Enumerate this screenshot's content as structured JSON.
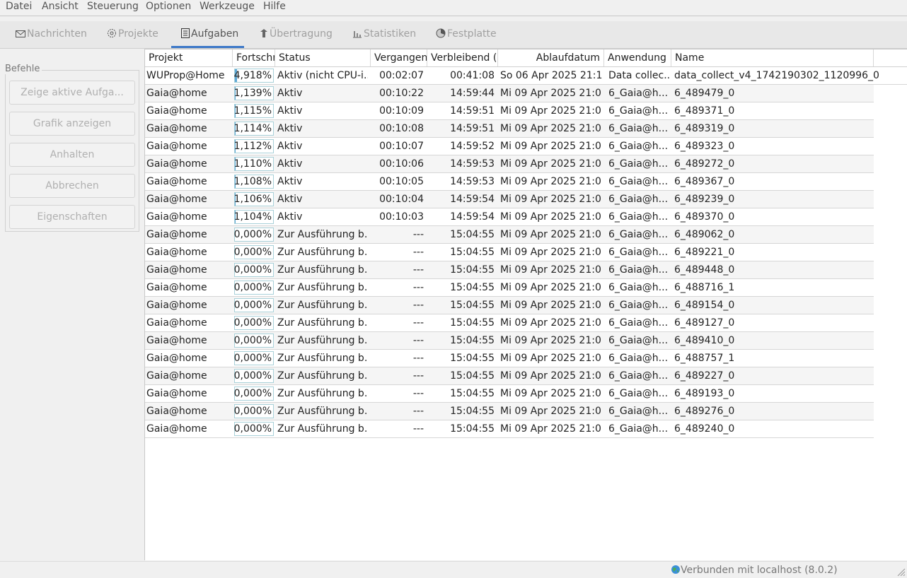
{
  "menu": [
    "Datei",
    "Ansicht",
    "Steuerung",
    "Optionen",
    "Werkzeuge",
    "Hilfe"
  ],
  "tabs": [
    {
      "label": "Nachrichten",
      "icon": "envelope-icon"
    },
    {
      "label": "Projekte",
      "icon": "projects-icon"
    },
    {
      "label": "Aufgaben",
      "icon": "tasks-icon",
      "active": true
    },
    {
      "label": "Übertragung",
      "icon": "transfer-icon"
    },
    {
      "label": "Statistiken",
      "icon": "statistics-icon"
    },
    {
      "label": "Festplatte",
      "icon": "disk-icon"
    }
  ],
  "commands": {
    "title": "Befehle",
    "buttons": [
      "Zeige aktive Aufga...",
      "Grafik anzeigen",
      "Anhalten",
      "Abbrechen",
      "Eigenschaften"
    ]
  },
  "columns": [
    "Projekt",
    "Fortschr",
    "Status",
    "Vergangen",
    "Verbleibend (g",
    "Ablaufdatum",
    "Anwendung",
    "Name"
  ],
  "rows": [
    {
      "project": "WUProp@Home",
      "progress": "4,918%",
      "progress_value": 4.918,
      "status": "Aktiv (nicht CPU-i...",
      "elapsed": "00:02:07",
      "remaining": "00:41:08",
      "deadline": "So 06 Apr 2025 21:1...",
      "app": "Data collec...",
      "name": "data_collect_v4_1742190302_1120996_0"
    },
    {
      "project": "Gaia@home",
      "progress": "1,139%",
      "progress_value": 1.139,
      "status": "Aktiv",
      "elapsed": "00:10:22",
      "remaining": "14:59:44",
      "deadline": "Mi 09 Apr 2025 21:0...",
      "app": "6_Gaia@h...",
      "name": "6_489479_0"
    },
    {
      "project": "Gaia@home",
      "progress": "1,115%",
      "progress_value": 1.115,
      "status": "Aktiv",
      "elapsed": "00:10:09",
      "remaining": "14:59:51",
      "deadline": "Mi 09 Apr 2025 21:0...",
      "app": "6_Gaia@h...",
      "name": "6_489371_0"
    },
    {
      "project": "Gaia@home",
      "progress": "1,114%",
      "progress_value": 1.114,
      "status": "Aktiv",
      "elapsed": "00:10:08",
      "remaining": "14:59:51",
      "deadline": "Mi 09 Apr 2025 21:0...",
      "app": "6_Gaia@h...",
      "name": "6_489319_0"
    },
    {
      "project": "Gaia@home",
      "progress": "1,112%",
      "progress_value": 1.112,
      "status": "Aktiv",
      "elapsed": "00:10:07",
      "remaining": "14:59:52",
      "deadline": "Mi 09 Apr 2025 21:0...",
      "app": "6_Gaia@h...",
      "name": "6_489323_0"
    },
    {
      "project": "Gaia@home",
      "progress": "1,110%",
      "progress_value": 1.11,
      "status": "Aktiv",
      "elapsed": "00:10:06",
      "remaining": "14:59:53",
      "deadline": "Mi 09 Apr 2025 21:0...",
      "app": "6_Gaia@h...",
      "name": "6_489272_0"
    },
    {
      "project": "Gaia@home",
      "progress": "1,108%",
      "progress_value": 1.108,
      "status": "Aktiv",
      "elapsed": "00:10:05",
      "remaining": "14:59:53",
      "deadline": "Mi 09 Apr 2025 21:0...",
      "app": "6_Gaia@h...",
      "name": "6_489367_0"
    },
    {
      "project": "Gaia@home",
      "progress": "1,106%",
      "progress_value": 1.106,
      "status": "Aktiv",
      "elapsed": "00:10:04",
      "remaining": "14:59:54",
      "deadline": "Mi 09 Apr 2025 21:0...",
      "app": "6_Gaia@h...",
      "name": "6_489239_0"
    },
    {
      "project": "Gaia@home",
      "progress": "1,104%",
      "progress_value": 1.104,
      "status": "Aktiv",
      "elapsed": "00:10:03",
      "remaining": "14:59:54",
      "deadline": "Mi 09 Apr 2025 21:0...",
      "app": "6_Gaia@h...",
      "name": "6_489370_0"
    },
    {
      "project": "Gaia@home",
      "progress": "0,000%",
      "progress_value": 0,
      "status": "Zur Ausführung b...",
      "elapsed": "---",
      "remaining": "15:04:55",
      "deadline": "Mi 09 Apr 2025 21:0...",
      "app": "6_Gaia@h...",
      "name": "6_489062_0"
    },
    {
      "project": "Gaia@home",
      "progress": "0,000%",
      "progress_value": 0,
      "status": "Zur Ausführung b...",
      "elapsed": "---",
      "remaining": "15:04:55",
      "deadline": "Mi 09 Apr 2025 21:0...",
      "app": "6_Gaia@h...",
      "name": "6_489221_0"
    },
    {
      "project": "Gaia@home",
      "progress": "0,000%",
      "progress_value": 0,
      "status": "Zur Ausführung b...",
      "elapsed": "---",
      "remaining": "15:04:55",
      "deadline": "Mi 09 Apr 2025 21:0...",
      "app": "6_Gaia@h...",
      "name": "6_489448_0"
    },
    {
      "project": "Gaia@home",
      "progress": "0,000%",
      "progress_value": 0,
      "status": "Zur Ausführung b...",
      "elapsed": "---",
      "remaining": "15:04:55",
      "deadline": "Mi 09 Apr 2025 21:0...",
      "app": "6_Gaia@h...",
      "name": "6_488716_1"
    },
    {
      "project": "Gaia@home",
      "progress": "0,000%",
      "progress_value": 0,
      "status": "Zur Ausführung b...",
      "elapsed": "---",
      "remaining": "15:04:55",
      "deadline": "Mi 09 Apr 2025 21:0...",
      "app": "6_Gaia@h...",
      "name": "6_489154_0"
    },
    {
      "project": "Gaia@home",
      "progress": "0,000%",
      "progress_value": 0,
      "status": "Zur Ausführung b...",
      "elapsed": "---",
      "remaining": "15:04:55",
      "deadline": "Mi 09 Apr 2025 21:0...",
      "app": "6_Gaia@h...",
      "name": "6_489127_0"
    },
    {
      "project": "Gaia@home",
      "progress": "0,000%",
      "progress_value": 0,
      "status": "Zur Ausführung b...",
      "elapsed": "---",
      "remaining": "15:04:55",
      "deadline": "Mi 09 Apr 2025 21:0...",
      "app": "6_Gaia@h...",
      "name": "6_489410_0"
    },
    {
      "project": "Gaia@home",
      "progress": "0,000%",
      "progress_value": 0,
      "status": "Zur Ausführung b...",
      "elapsed": "---",
      "remaining": "15:04:55",
      "deadline": "Mi 09 Apr 2025 21:0...",
      "app": "6_Gaia@h...",
      "name": "6_488757_1"
    },
    {
      "project": "Gaia@home",
      "progress": "0,000%",
      "progress_value": 0,
      "status": "Zur Ausführung b...",
      "elapsed": "---",
      "remaining": "15:04:55",
      "deadline": "Mi 09 Apr 2025 21:0...",
      "app": "6_Gaia@h...",
      "name": "6_489227_0"
    },
    {
      "project": "Gaia@home",
      "progress": "0,000%",
      "progress_value": 0,
      "status": "Zur Ausführung b...",
      "elapsed": "---",
      "remaining": "15:04:55",
      "deadline": "Mi 09 Apr 2025 21:0...",
      "app": "6_Gaia@h...",
      "name": "6_489193_0"
    },
    {
      "project": "Gaia@home",
      "progress": "0,000%",
      "progress_value": 0,
      "status": "Zur Ausführung b...",
      "elapsed": "---",
      "remaining": "15:04:55",
      "deadline": "Mi 09 Apr 2025 21:0...",
      "app": "6_Gaia@h...",
      "name": "6_489276_0"
    },
    {
      "project": "Gaia@home",
      "progress": "0,000%",
      "progress_value": 0,
      "status": "Zur Ausführung b...",
      "elapsed": "---",
      "remaining": "15:04:55",
      "deadline": "Mi 09 Apr 2025 21:0...",
      "app": "6_Gaia@h...",
      "name": "6_489240_0"
    }
  ],
  "status_bar": {
    "connection": "Verbunden mit localhost (8.0.2)",
    "icon": "globe-icon"
  },
  "colors": {
    "accent": "#3c78c8",
    "progress_fill": "#5fa9d6"
  }
}
